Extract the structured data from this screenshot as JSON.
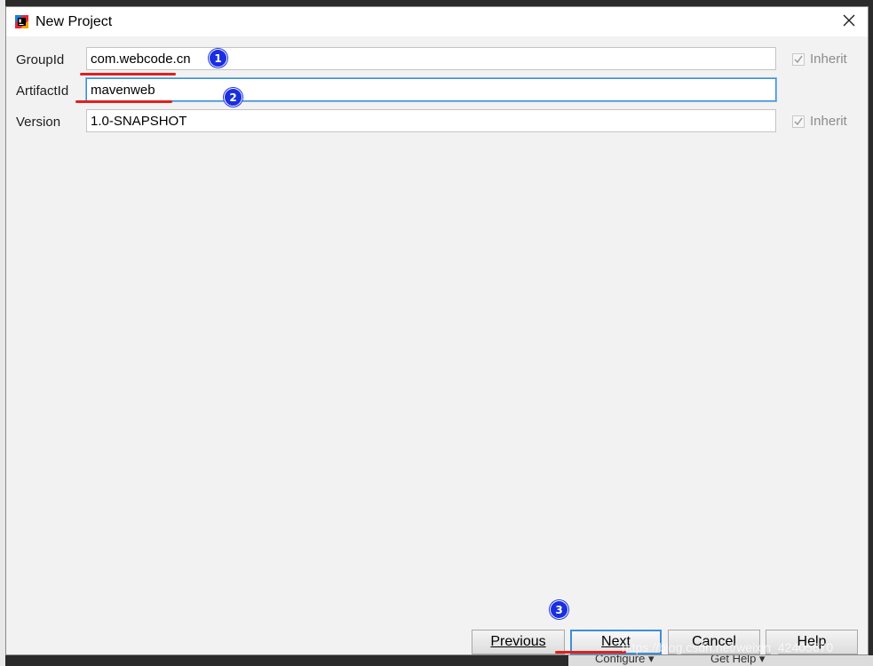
{
  "dialog": {
    "title": "New Project",
    "close_symbol": "✕"
  },
  "form": {
    "group_id": {
      "label": "GroupId",
      "value": "com.webcode.cn",
      "inherit_label": "Inherit",
      "inherit_checked": true
    },
    "artifact_id": {
      "label": "ArtifactId",
      "value": "mavenweb"
    },
    "version": {
      "label": "Version",
      "value": "1.0-SNAPSHOT",
      "inherit_label": "Inherit",
      "inherit_checked": true
    }
  },
  "annotations": {
    "badge_1": "1",
    "badge_2": "2",
    "badge_3": "3",
    "underline_color": "#e02020",
    "badge_color": "#1a2fe0"
  },
  "buttons": {
    "previous": "Previous",
    "next": "Next",
    "cancel": "Cancel",
    "help": "Help"
  },
  "background": {
    "bottom_left_text": "Configure ▾",
    "bottom_right_text": "Get Help ▾",
    "watermark": "https://blog.csdn.net/weixin_42405670"
  },
  "colors": {
    "focus_border": "#3d8fd6",
    "dialog_bg": "#f2f2f2"
  }
}
